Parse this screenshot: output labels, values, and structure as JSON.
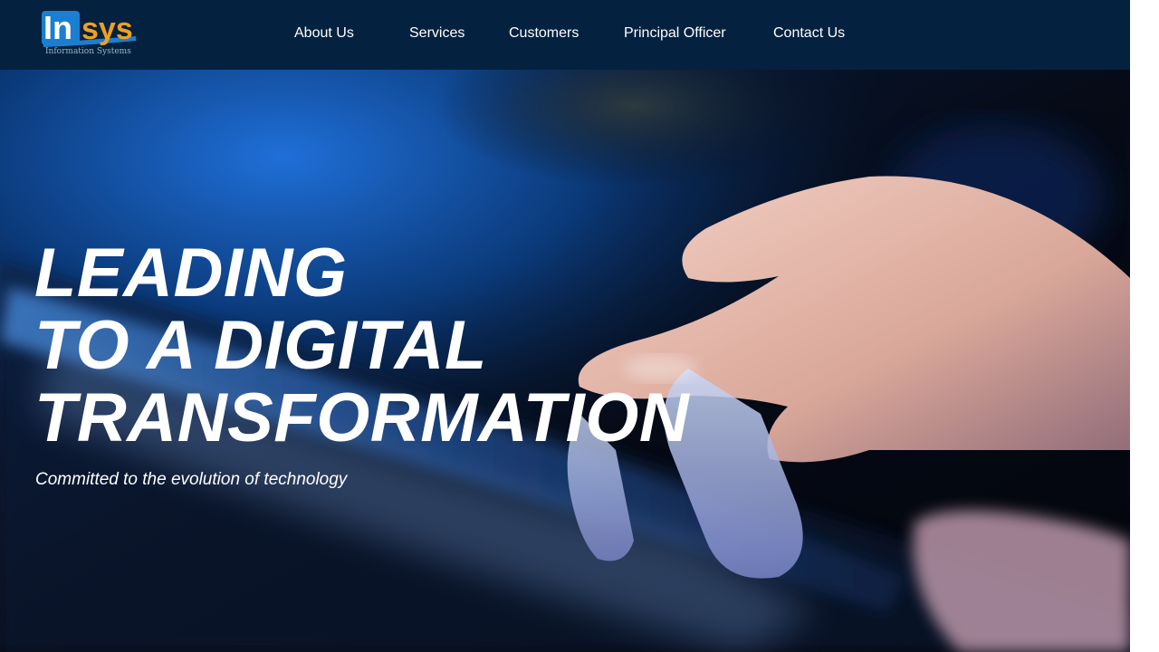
{
  "brand": {
    "logo_text_part1": "In",
    "logo_text_part2": "sys",
    "tagline": "Information Systems",
    "colors": {
      "header_bg": "#04223f",
      "logo_blue": "#1a7fd0",
      "logo_orange": "#f0a020"
    }
  },
  "nav": {
    "items": [
      {
        "label": "About Us"
      },
      {
        "label": "Services"
      },
      {
        "label": "Customers"
      },
      {
        "label": "Principal Officer"
      },
      {
        "label": "Contact Us"
      }
    ]
  },
  "hero": {
    "title_lines": [
      "LEADING",
      "TO A DIGITAL",
      "TRANSFORMATION"
    ],
    "subtitle": "Committed to the evolution of technology",
    "image": "hand-touching-tablet-photo"
  }
}
